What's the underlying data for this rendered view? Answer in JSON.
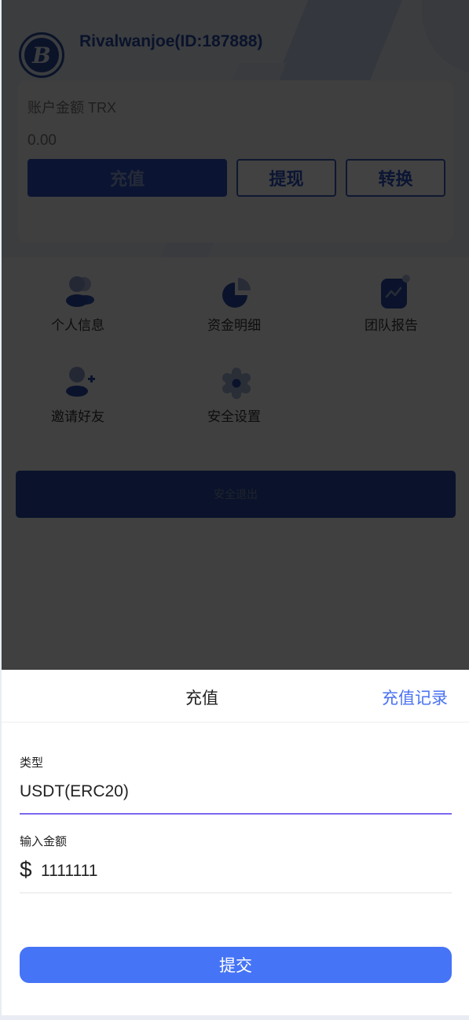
{
  "profile": {
    "avatar_icon": "bitcoin-icon",
    "avatar_glyph": "B",
    "username": "Rivalwanjoe(ID:187888)"
  },
  "balance": {
    "label": "账户金额 TRX",
    "value": "0.00",
    "buttons": {
      "recharge": "充值",
      "withdraw": "提现",
      "convert": "转换"
    }
  },
  "menu": {
    "items": [
      {
        "label": "个人信息",
        "icon": "users-icon"
      },
      {
        "label": "资金明细",
        "icon": "pie-chart-icon"
      },
      {
        "label": "团队报告",
        "icon": "trend-report-icon"
      },
      {
        "label": "邀请好友",
        "icon": "add-user-icon"
      },
      {
        "label": "安全设置",
        "icon": "gear-icon"
      }
    ]
  },
  "logout_label": "安全退出",
  "sheet": {
    "title": "充值",
    "history_link": "充值记录",
    "type_label": "类型",
    "type_value": "USDT(ERC20)",
    "amount_label": "输入金额",
    "currency_symbol": "$",
    "amount_value": "1111111",
    "submit_label": "提交"
  },
  "colors": {
    "brand": "#2c52c4",
    "accent_link": "#4b73f1",
    "submit": "#4674f6",
    "focus_underline": "#7b68ee"
  }
}
